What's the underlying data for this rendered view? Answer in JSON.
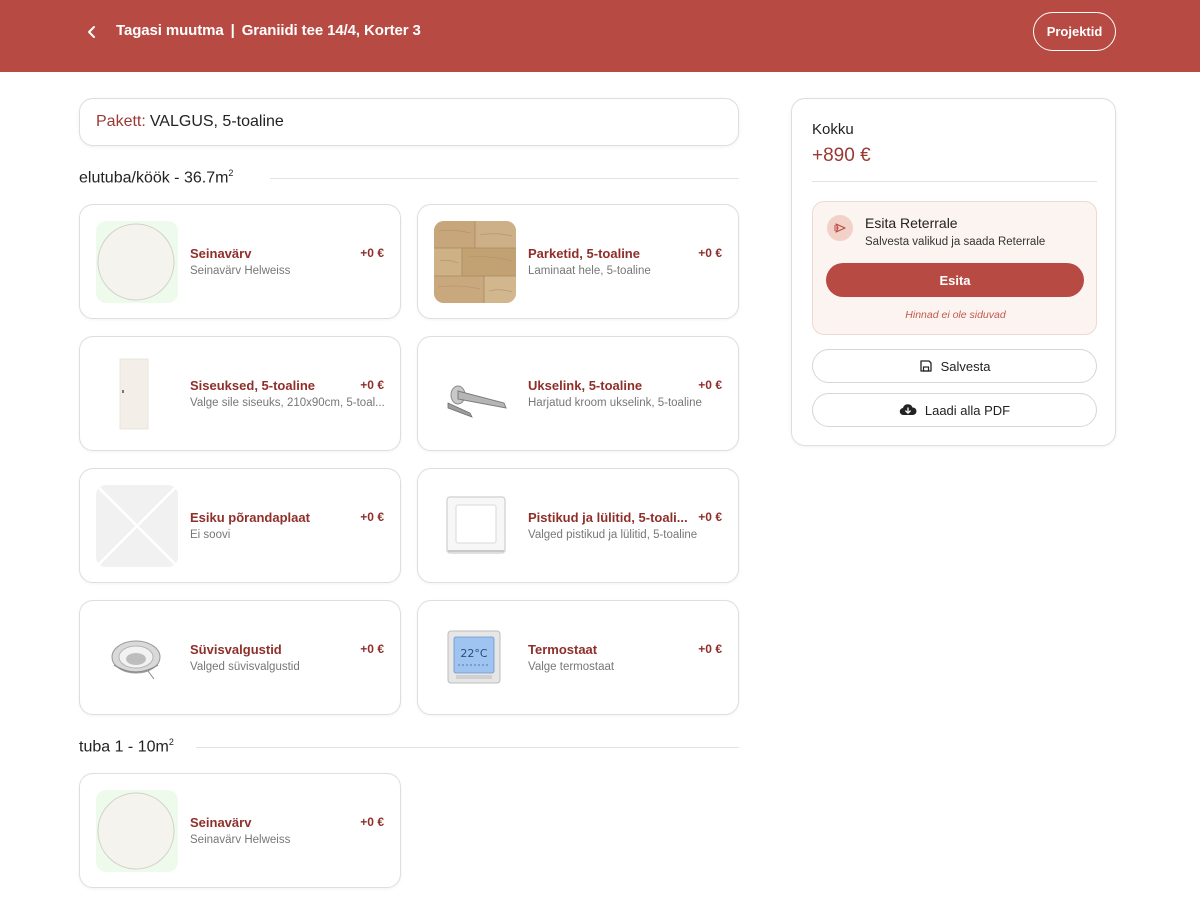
{
  "header": {
    "back_icon": "chevron-left-icon",
    "back_label": "Tagasi muutma",
    "separator": "|",
    "address": "Graniidi tee 14/4, Korter 3",
    "projects_label": "Projektid"
  },
  "package": {
    "label": "Pakett:",
    "value": "VALGUS, 5-toaline"
  },
  "sections": [
    {
      "title": "elutuba/köök - 36.7m",
      "title_sup": "2",
      "items": [
        {
          "name": "Seinavärv",
          "price": "+0 €",
          "desc": "Seinavärv Helweiss",
          "image": "paint-swatch-circle"
        },
        {
          "name": "Parketid, 5-toaline",
          "price": "+0 €",
          "desc": "Laminaat hele, 5-toaline",
          "image": "wood-floor-texture"
        },
        {
          "name": "Siseuksed, 5-toaline",
          "price": "+0 €",
          "desc": "Valge sile siseuks, 210x90cm, 5-toal...",
          "image": "white-door"
        },
        {
          "name": "Ukselink, 5-toaline",
          "price": "+0 €",
          "desc": "Harjatud kroom ukselink, 5-toaline",
          "image": "door-handle"
        },
        {
          "name": "Esiku põrandaplaat",
          "price": "+0 €",
          "desc": "Ei soovi",
          "image": "placeholder-x"
        },
        {
          "name": "Pistikud ja lülitid, 5-toali...",
          "price": "+0 €",
          "desc": "Valged pistikud ja lülitid, 5-toaline",
          "image": "light-switch"
        },
        {
          "name": "Süvisvalgustid",
          "price": "+0 €",
          "desc": "Valged süvisvalgustid",
          "image": "recessed-light"
        },
        {
          "name": "Termostaat",
          "price": "+0 €",
          "desc": "Valge termostaat",
          "image": "thermostat",
          "thermostat_reading": "22°C"
        }
      ]
    },
    {
      "title": "tuba 1 - 10m",
      "title_sup": "2",
      "items": [
        {
          "name": "Seinavärv",
          "price": "+0 €",
          "desc": "Seinavärv Helweiss",
          "image": "paint-swatch-circle"
        }
      ]
    }
  ],
  "summary": {
    "label": "Kokku",
    "total": "+890 €",
    "submit": {
      "icon": "send-icon",
      "title": "Esita Reterrale",
      "subtitle": "Salvesta valikud ja saada Reterrale",
      "button": "Esita",
      "note": "Hinnad ei ole siduvad"
    },
    "save_icon": "floppy-disk-icon",
    "save_label": "Salvesta",
    "download_icon": "cloud-download-icon",
    "download_label": "Laadi alla PDF"
  },
  "colors": {
    "brand": "#b74a43",
    "accent_text": "#8f2f2a",
    "submit_bg": "#fcf4f0"
  }
}
